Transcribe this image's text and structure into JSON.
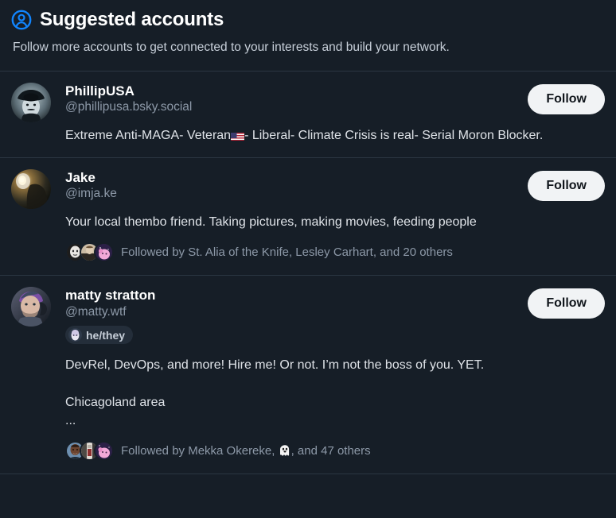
{
  "header": {
    "icon": "person-circle-icon",
    "icon_color": "#1185fe",
    "title": "Suggested accounts",
    "subtitle": "Follow more accounts to get connected to your interests and build your network."
  },
  "theme": {
    "background": "#161e27",
    "separator": "#2b3642",
    "text_primary": "#ffffff",
    "text_secondary": "#8d99a8",
    "text_bio": "#dfe3e8",
    "accent": "#1185fe",
    "follow_button_bg": "#f1f3f5",
    "follow_button_text": "#11161c"
  },
  "accounts": [
    {
      "display_name": "PhillipUSA",
      "handle": "@phillipusa.bsky.social",
      "bio_before_flag": "Extreme Anti-MAGA- Veteran",
      "bio_flag": "🇺🇸",
      "bio_after_flag": "- Liberal- Climate Crisis is real- Serial Moron Blocker.",
      "follow_label": "Follow",
      "pronouns": null,
      "followed_by": null
    },
    {
      "display_name": "Jake",
      "handle": "@imja.ke",
      "bio": "Your local thembo friend. Taking pictures, making movies, feeding people",
      "follow_label": "Follow",
      "pronouns": null,
      "followed_by": {
        "text": "Followed by St. Alia of the Knife, Lesley Carhart, and 20 others",
        "avatar_count": 3
      }
    },
    {
      "display_name": "matty stratton",
      "handle": "@matty.wtf",
      "bio": "DevRel, DevOps, and more! Hire me! Or not. I’m not the boss of you. YET.\n\nChicagoland area\n...",
      "follow_label": "Follow",
      "pronouns": "he/they",
      "followed_by": {
        "text_before_ghost": "Followed by Mekka Okereke, ",
        "ghost_emoji": "👻",
        "text_after_ghost": ", and 47 others",
        "avatar_count": 3
      }
    }
  ]
}
